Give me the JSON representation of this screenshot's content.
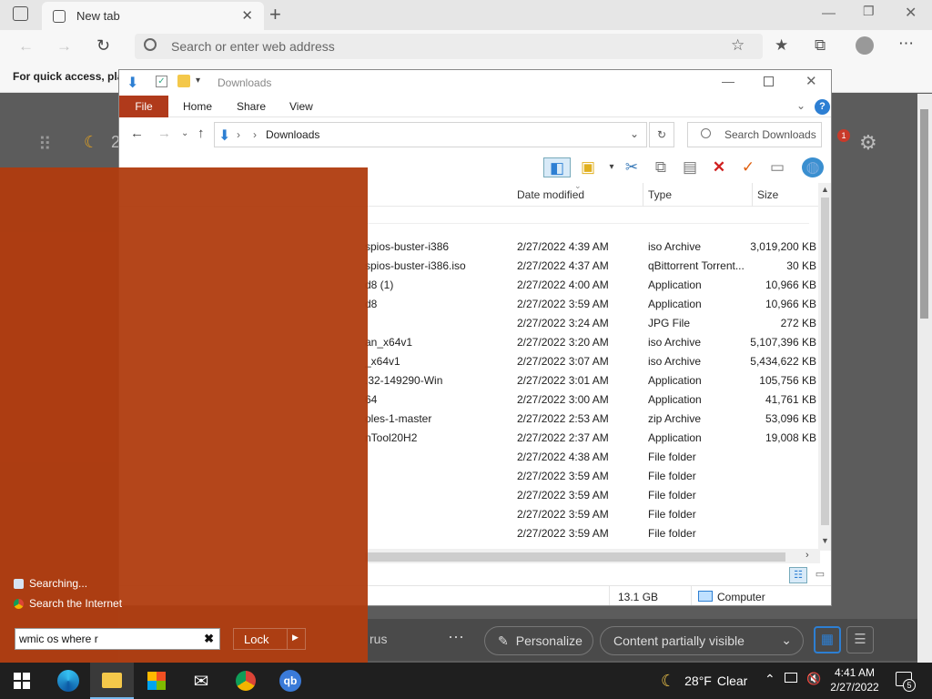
{
  "browser": {
    "tab_title": "New tab",
    "address_placeholder": "Search or enter web address",
    "favorites_hint": "For quick access, plac"
  },
  "newtab": {
    "personalize_label": "Personalize",
    "content_label": "Content partially visible",
    "notification_count": "1",
    "partial_label": "rus",
    "weather_partial": "2"
  },
  "explorer": {
    "title": "Downloads",
    "ribbon_tabs": [
      "File",
      "Home",
      "Share",
      "View"
    ],
    "path": "Downloads",
    "search_placeholder": "Search Downloads",
    "columns": {
      "date": "Date modified",
      "type": "Type",
      "size": "Size"
    },
    "rows": [
      {
        "name": "spios-buster-i386",
        "date": "2/27/2022 4:39 AM",
        "type": "iso Archive",
        "size": "3,019,200 KB"
      },
      {
        "name": "spios-buster-i386.iso",
        "date": "2/27/2022 4:37 AM",
        "type": "qBittorrent Torrent...",
        "size": "30 KB"
      },
      {
        "name": "d8 (1)",
        "date": "2/27/2022 4:00 AM",
        "type": "Application",
        "size": "10,966 KB"
      },
      {
        "name": "d8",
        "date": "2/27/2022 3:59 AM",
        "type": "Application",
        "size": "10,966 KB"
      },
      {
        "name": "",
        "date": "2/27/2022 3:24 AM",
        "type": "JPG File",
        "size": "272 KB"
      },
      {
        "name": "an_x64v1",
        "date": "2/27/2022 3:20 AM",
        "type": "iso Archive",
        "size": "5,107,396 KB"
      },
      {
        "name": "_x64v1",
        "date": "2/27/2022 3:07 AM",
        "type": "iso Archive",
        "size": "5,434,622 KB"
      },
      {
        "name": ".32-149290-Win",
        "date": "2/27/2022 3:01 AM",
        "type": "Application",
        "size": "105,756 KB"
      },
      {
        "name": "64",
        "date": "2/27/2022 3:00 AM",
        "type": "Application",
        "size": "41,761 KB"
      },
      {
        "name": "oles-1-master",
        "date": "2/27/2022 2:53 AM",
        "type": "zip Archive",
        "size": "53,096 KB"
      },
      {
        "name": "nTool20H2",
        "date": "2/27/2022 2:37 AM",
        "type": "Application",
        "size": "19,008 KB"
      },
      {
        "name": "",
        "date": "2/27/2022 4:38 AM",
        "type": "File folder",
        "size": ""
      },
      {
        "name": "",
        "date": "2/27/2022 3:59 AM",
        "type": "File folder",
        "size": ""
      },
      {
        "name": "",
        "date": "2/27/2022 3:59 AM",
        "type": "File folder",
        "size": ""
      },
      {
        "name": "",
        "date": "2/27/2022 3:59 AM",
        "type": "File folder",
        "size": ""
      },
      {
        "name": "",
        "date": "2/27/2022 3:59 AM",
        "type": "File folder",
        "size": ""
      }
    ],
    "status_size": "13.1 GB",
    "status_location": "Computer"
  },
  "startmenu": {
    "searching_label": "Searching...",
    "search_internet_label": "Search the Internet",
    "search_value": "wmic os where r",
    "lock_label": "Lock"
  },
  "taskbar": {
    "temperature": "28°F",
    "condition": "Clear",
    "time": "4:41 AM",
    "date": "2/27/2022",
    "notification_count": "5"
  },
  "colors": {
    "accent_orange": "#b03a1b",
    "taskbar": "#1f1f1f",
    "explorer_blue": "#2d7fd3"
  }
}
